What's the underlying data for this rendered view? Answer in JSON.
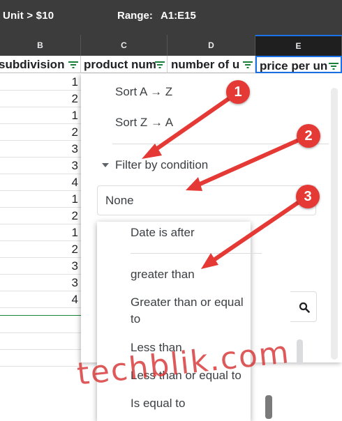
{
  "toolbar": {
    "name_box": "Unit > $10",
    "range_label": "Range:",
    "range_value": "A1:E15"
  },
  "column_letters": [
    "B",
    "C",
    "D",
    "E"
  ],
  "headers": [
    "subdivision",
    "product num",
    "number of u",
    "price per un"
  ],
  "rows": [
    "1",
    "2",
    "1",
    "2",
    "3",
    "3",
    "4",
    "1",
    "2",
    "1",
    "2",
    "3",
    "3",
    "4"
  ],
  "filter_menu": {
    "sort_az": "Sort A → Z",
    "sort_za": "Sort Z → A",
    "filter_by_condition": "Filter by condition",
    "condition_value": "None"
  },
  "condition_options": [
    "Date is after",
    "greater than",
    "Greater than or equal to",
    "Less than",
    "Less than or equal to",
    "Is equal to"
  ],
  "callouts": [
    "1",
    "2",
    "3"
  ],
  "watermark": "techblik.com",
  "colors": {
    "accent": "#1a73e8",
    "callout": "#e53935",
    "filter_icon": "#188038",
    "toolbar_bg": "#3c3c3c"
  }
}
